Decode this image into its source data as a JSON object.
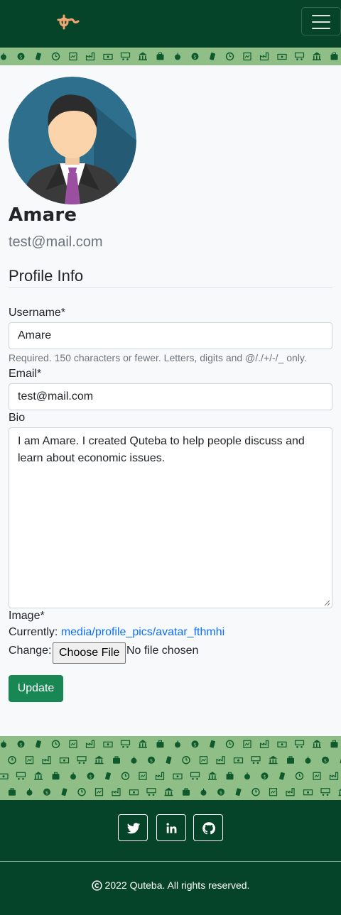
{
  "navbar": {
    "logo_icon": "quteba-logo-icon",
    "menu_icon": "hamburger-menu-icon",
    "bg": "#054428"
  },
  "banner_icons": [
    "apple-icon",
    "dollar-icon",
    "document-icon",
    "clock-icon",
    "chart-icon",
    "factory-icon",
    "banknote-icon",
    "cart-icon",
    "bank-icon",
    "briefcase-icon"
  ],
  "profile": {
    "name": "Amare",
    "email": "test@mail.com",
    "avatar_icon": "user-avatar-icon"
  },
  "form": {
    "section_title": "Profile Info",
    "username_label": "Username*",
    "username_value": "Amare",
    "username_help": "Required. 150 characters or fewer. Letters, digits and @/./+/-/_ only.",
    "email_label": "Email*",
    "email_value": "test@mail.com",
    "bio_label": "Bio",
    "bio_value": "I am Amare. I created Quteba to help people discuss and learn about economic issues.",
    "image_label": "Image*",
    "currently_label": "Currently:",
    "currently_link": "media/profile_pics/avatar_fthmhi",
    "change_label": "Change:",
    "choose_file": "Choose File",
    "no_file": "No file chosen",
    "update_button": "Update"
  },
  "footer": {
    "social": [
      "twitter-icon",
      "linkedin-icon",
      "github-icon"
    ],
    "copyright": "2022 Quteba. All rights reserved.",
    "accent": "#198754"
  }
}
